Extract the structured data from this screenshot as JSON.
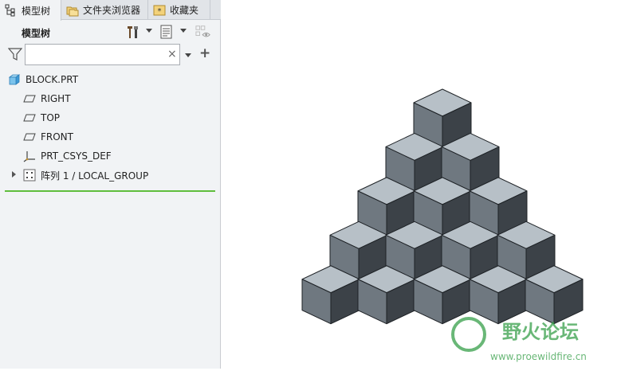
{
  "tabs": [
    {
      "label": "模型树"
    },
    {
      "label": "文件夹浏览器"
    },
    {
      "label": "收藏夹"
    }
  ],
  "panel": {
    "title": "模型树",
    "search_value": ""
  },
  "tree": {
    "root": "BLOCK.PRT",
    "items": [
      {
        "label": "RIGHT"
      },
      {
        "label": "TOP"
      },
      {
        "label": "FRONT"
      },
      {
        "label": "PRT_CSYS_DEF"
      },
      {
        "label": "阵列 1 / LOCAL_GROUP"
      }
    ]
  },
  "watermark": {
    "name": "野火论坛",
    "url": "www.proewildfire.cn"
  },
  "colors": {
    "accent_line": "#5fbd3c",
    "cube_top": "#b7c0c7",
    "cube_left": "#6f7880",
    "cube_right": "#3c4248",
    "watermark": "#37a04a"
  }
}
